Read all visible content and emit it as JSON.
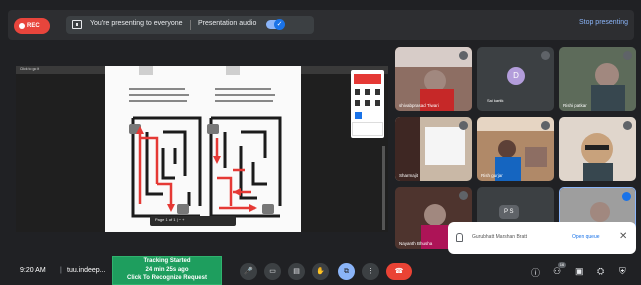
{
  "topbar": {
    "rec_label": "REC",
    "presenting_text": "You're presenting to everyone",
    "audio_label": "Presentation audio",
    "stop_label": "Stop presenting"
  },
  "shared_screen": {
    "tab_label": "Click to go it",
    "toolbar_text": "Page 1 of 1  |  −  +"
  },
  "tiles": [
    {
      "name": "shivabprasad Tiwari"
    },
    {
      "name": "Sai kartik",
      "avatar_letter": "D"
    },
    {
      "name": "Rishi patkar"
    },
    {
      "name": "Sharmajit"
    },
    {
      "name": "Rish gurjar"
    },
    {
      "name": ""
    },
    {
      "name": "Nayanth Bhusha",
      "avatar_letters": "R"
    },
    {
      "name": "",
      "avatar_letters": "P  S"
    },
    {
      "name": ""
    }
  ],
  "notification": {
    "text": "Gurubhatt Marshan Bratt",
    "link": "Open queue",
    "close": "✕"
  },
  "bottombar": {
    "time": "9:20 AM",
    "separator": "|",
    "meeting_code": "tuu.indeep...",
    "tracking_line1": "Tracking Started",
    "tracking_line2": "24 min 25s ago",
    "tracking_line3": "Click To Recognize Request",
    "people_count": "16"
  },
  "colors": {
    "rec": "#e8453c",
    "accent": "#8ab4f8",
    "end_call": "#ea4335",
    "tracking": "#1e9e5e"
  }
}
